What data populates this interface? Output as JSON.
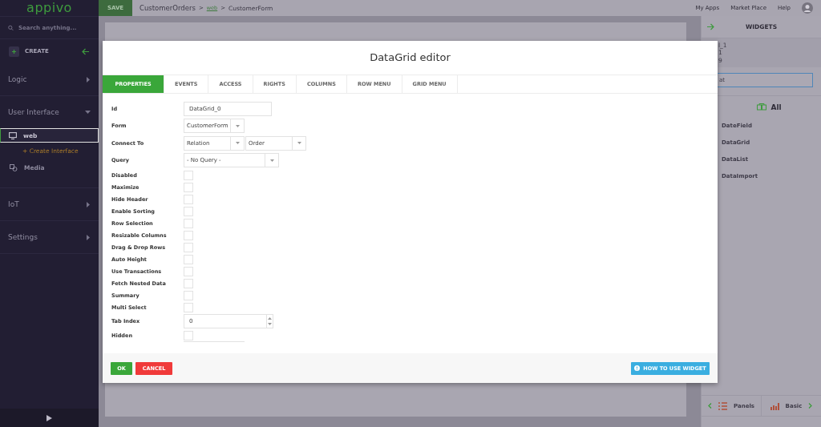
{
  "sidebar": {
    "logo": "appivo",
    "search": {
      "placeholder": "Search anything..."
    },
    "create": "CREATE",
    "sections": [
      {
        "label": "Logic",
        "expanded": false
      },
      {
        "label": "User Interface",
        "expanded": true,
        "children": [
          {
            "label": "web",
            "kind": "page",
            "selected": true
          },
          {
            "label": "+ Create Interface",
            "kind": "action",
            "selected": false
          },
          {
            "label": "Media",
            "kind": "media",
            "selected": false
          }
        ]
      },
      {
        "label": "IoT",
        "expanded": false
      },
      {
        "label": "Settings",
        "expanded": false
      }
    ]
  },
  "top_bar": {
    "save": "SAVE",
    "breadcrumb": [
      {
        "label": "CustomerOrders",
        "kind": "plain"
      },
      {
        "label": ">",
        "kind": "separator"
      },
      {
        "label": "web",
        "kind": "link"
      },
      {
        "label": ">",
        "kind": "separator"
      },
      {
        "label": "CustomerForm",
        "kind": "plain"
      }
    ],
    "nav": [
      "My Apps",
      "Market Place",
      "Help"
    ]
  },
  "widgets_panel": {
    "title": "WIDGETS",
    "fragments": [
      "l_1",
      "1",
      "9"
    ],
    "search": {
      "value": "at"
    },
    "category": "All",
    "items": [
      "DateField",
      "DataGrid",
      "DataList",
      "DataImport"
    ],
    "prev": "Panels",
    "next": "Basic"
  },
  "dialog": {
    "title": "DataGrid editor",
    "tabs": [
      {
        "label": "PROPERTIES",
        "selected": true
      },
      {
        "label": "EVENTS",
        "selected": false
      },
      {
        "label": "ACCESS",
        "selected": false
      },
      {
        "label": "RIGHTS",
        "selected": false
      },
      {
        "label": "COLUMNS",
        "selected": false
      },
      {
        "label": "ROW MENU",
        "selected": false
      },
      {
        "label": "GRID MENU",
        "selected": false
      }
    ],
    "fields": [
      {
        "label": "Id",
        "kind": "text",
        "value": "DataGrid_0"
      },
      {
        "label": "Form",
        "kind": "select",
        "values": [
          "CustomerForm"
        ]
      },
      {
        "label": "Connect To",
        "kind": "select",
        "values": [
          "Relation",
          "Order"
        ]
      },
      {
        "label": "Query",
        "kind": "wide-select",
        "values": [
          "- No Query -"
        ]
      },
      {
        "label": "Disabled",
        "kind": "checkbox",
        "checked": false
      },
      {
        "label": "Maximize",
        "kind": "checkbox",
        "checked": false
      },
      {
        "label": "Hide Header",
        "kind": "checkbox",
        "checked": false
      },
      {
        "label": "Enable Sorting",
        "kind": "checkbox",
        "checked": false
      },
      {
        "label": "Row Selection",
        "kind": "checkbox",
        "checked": false
      },
      {
        "label": "Resizable Columns",
        "kind": "checkbox",
        "checked": false
      },
      {
        "label": "Drag & Drop Rows",
        "kind": "checkbox",
        "checked": false
      },
      {
        "label": "Auto Height",
        "kind": "checkbox",
        "checked": false
      },
      {
        "label": "Use Transactions",
        "kind": "checkbox",
        "checked": false
      },
      {
        "label": "Fetch Nested Data",
        "kind": "checkbox",
        "checked": false
      },
      {
        "label": "Summary",
        "kind": "checkbox",
        "checked": false
      },
      {
        "label": "Multi Select",
        "kind": "checkbox",
        "checked": false
      },
      {
        "label": "Tab Index",
        "kind": "number",
        "value": "0"
      },
      {
        "label": "Hidden",
        "kind": "checkbox",
        "checked": false
      }
    ],
    "ok": "OK",
    "cancel": "CANCEL",
    "help": "HOW TO USE WIDGET"
  }
}
